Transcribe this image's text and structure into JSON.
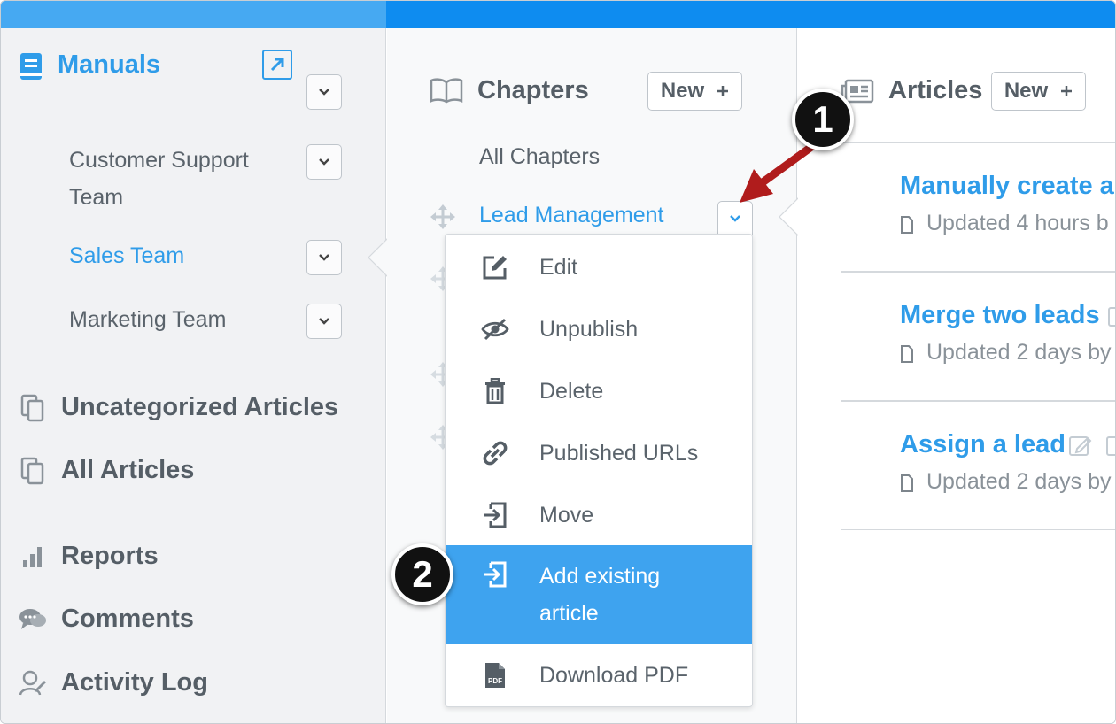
{
  "sidebar": {
    "manuals_label": "Manuals",
    "teams": [
      {
        "label": "Customer Support Team",
        "active": false
      },
      {
        "label": "Sales Team",
        "active": true
      },
      {
        "label": "Marketing Team",
        "active": false
      }
    ],
    "nav": [
      {
        "label": "Uncategorized Articles",
        "icon": "copy-icon"
      },
      {
        "label": "All Articles",
        "icon": "copy-icon"
      },
      {
        "label": "Reports",
        "icon": "bar-chart-icon"
      },
      {
        "label": "Comments",
        "icon": "comments-icon"
      },
      {
        "label": "Activity Log",
        "icon": "activity-log-icon"
      }
    ]
  },
  "chapters": {
    "title": "Chapters",
    "new_label": "New",
    "all_label": "All Chapters",
    "current": "Lead Management"
  },
  "menu": {
    "items": [
      {
        "label": "Edit",
        "icon": "edit-icon"
      },
      {
        "label": "Unpublish",
        "icon": "eye-slash-icon"
      },
      {
        "label": "Delete",
        "icon": "trash-icon"
      },
      {
        "label": "Published URLs",
        "icon": "link-icon"
      },
      {
        "label": "Move",
        "icon": "move-in-icon"
      },
      {
        "label": "Add existing article",
        "icon": "add-existing-icon",
        "selected": true
      },
      {
        "label": "Download PDF",
        "icon": "pdf-icon"
      }
    ]
  },
  "articles": {
    "title": "Articles",
    "new_label": "New",
    "items": [
      {
        "title": "Manually create a",
        "meta": "Updated 4 hours b"
      },
      {
        "title": "Merge two leads",
        "meta": "Updated 2 days by"
      },
      {
        "title": "Assign a lead",
        "meta": "Updated 2 days by"
      }
    ]
  },
  "annotations": {
    "step1": "1",
    "step2": "2"
  },
  "colors": {
    "accent": "#2f9ce9",
    "selected": "#3ea3ef",
    "arrow": "#b01c1c"
  }
}
